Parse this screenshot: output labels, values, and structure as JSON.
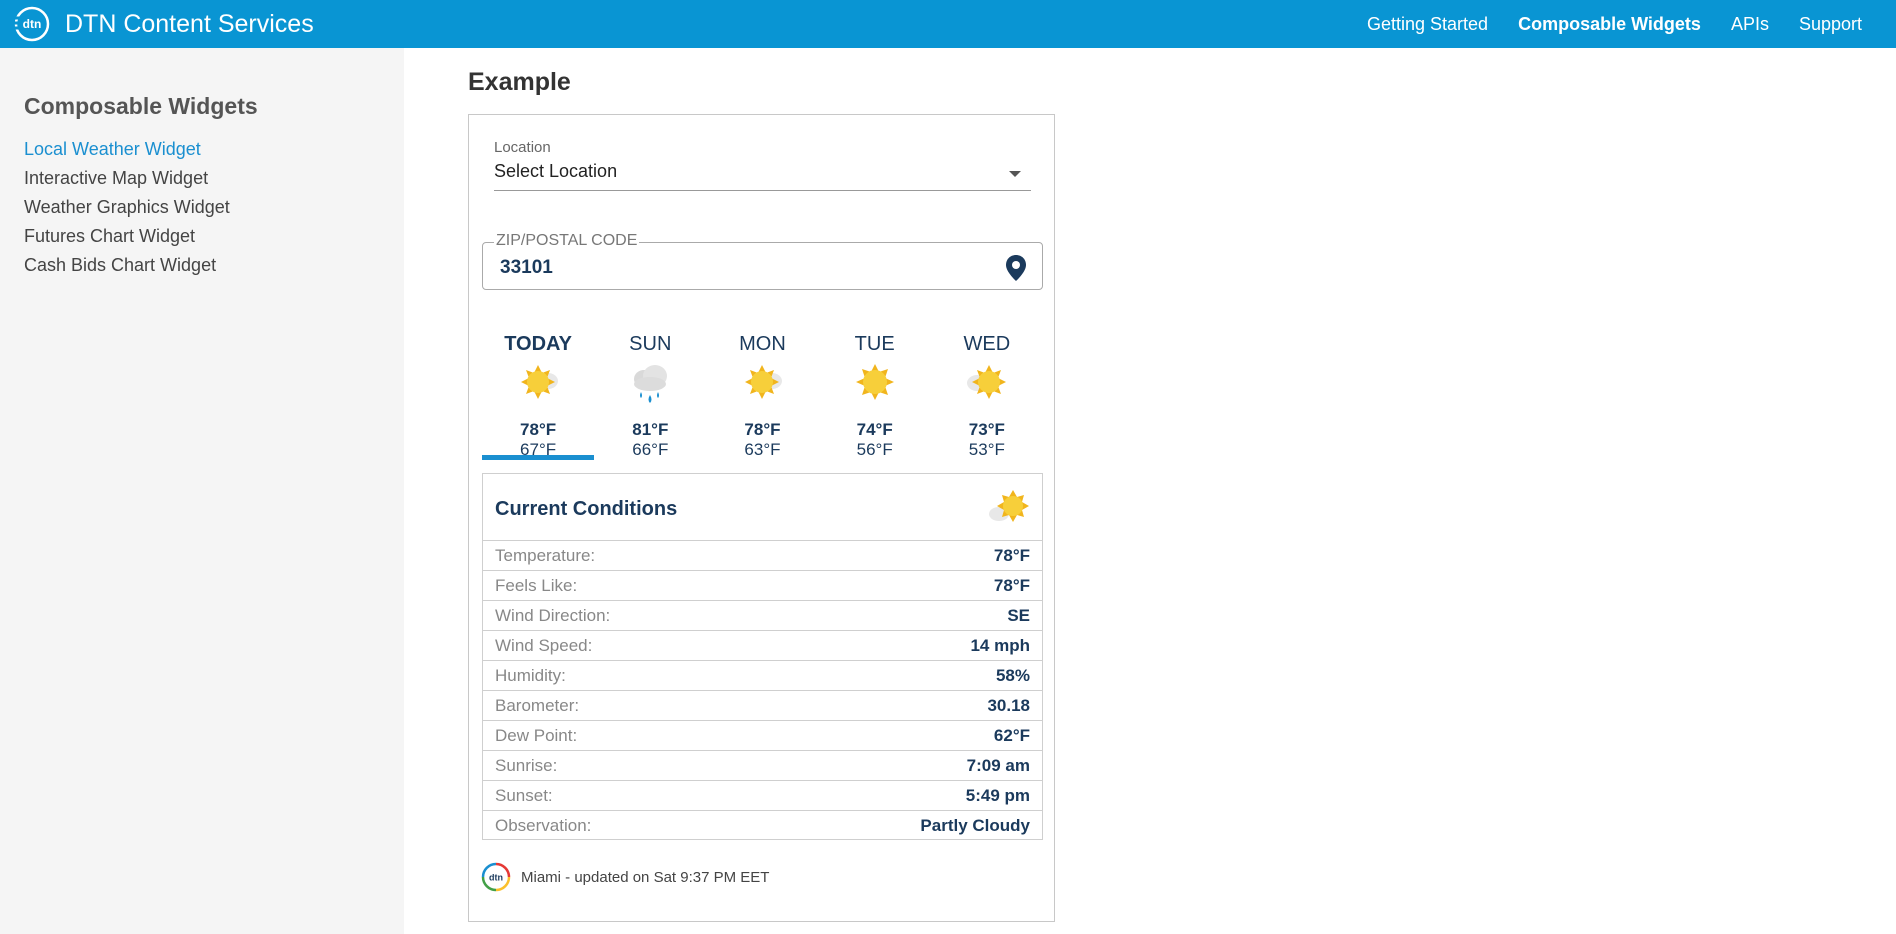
{
  "header": {
    "brand": "DTN Content Services",
    "logo_text": "dtn",
    "nav": [
      {
        "label": "Getting Started",
        "active": false
      },
      {
        "label": "Composable Widgets",
        "active": true
      },
      {
        "label": "APIs",
        "active": false
      },
      {
        "label": "Support",
        "active": false
      }
    ]
  },
  "sidebar": {
    "title": "Composable Widgets",
    "items": [
      {
        "label": "Local Weather Widget",
        "active": true
      },
      {
        "label": "Interactive Map Widget",
        "active": false
      },
      {
        "label": "Weather Graphics Widget",
        "active": false
      },
      {
        "label": "Futures Chart Widget",
        "active": false
      },
      {
        "label": "Cash Bids Chart Widget",
        "active": false
      }
    ]
  },
  "main": {
    "title": "Example"
  },
  "widget": {
    "location_label": "Location",
    "location_value": "Select Location",
    "zip_legend": "ZIP/POSTAL CODE",
    "zip_value": "33101",
    "forecast": [
      {
        "day": "TODAY",
        "hi": "78°F",
        "lo": "67°F",
        "icon": "partly-cloudy-sun-icon"
      },
      {
        "day": "SUN",
        "hi": "81°F",
        "lo": "66°F",
        "icon": "rain-cloud-icon"
      },
      {
        "day": "MON",
        "hi": "78°F",
        "lo": "63°F",
        "icon": "partly-cloudy-sun-icon"
      },
      {
        "day": "TUE",
        "hi": "74°F",
        "lo": "56°F",
        "icon": "sun-icon"
      },
      {
        "day": "WED",
        "hi": "73°F",
        "lo": "53°F",
        "icon": "partly-cloudy-sun-icon"
      }
    ],
    "current": {
      "title": "Current Conditions",
      "icon": "partly-cloudy-sun-icon",
      "rows": [
        {
          "label": "Temperature:",
          "value": "78°F"
        },
        {
          "label": "Feels Like:",
          "value": "78°F"
        },
        {
          "label": "Wind Direction:",
          "value": "SE"
        },
        {
          "label": "Wind Speed:",
          "value": "14 mph"
        },
        {
          "label": "Humidity:",
          "value": "58%"
        },
        {
          "label": "Barometer:",
          "value": "30.18"
        },
        {
          "label": "Dew Point:",
          "value": "62°F"
        },
        {
          "label": "Sunrise:",
          "value": "7:09 am"
        },
        {
          "label": "Sunset:",
          "value": "5:49 pm"
        },
        {
          "label": "Observation:",
          "value": "Partly Cloudy"
        }
      ]
    },
    "footer_text": "Miami - updated on Sat 9:37 PM EET",
    "footer_logo_text": "dtn"
  },
  "colors": {
    "header_bg": "#0995d3",
    "accent": "#1a8fd0",
    "navy": "#1b3a5c",
    "sun": "#f5c518"
  }
}
